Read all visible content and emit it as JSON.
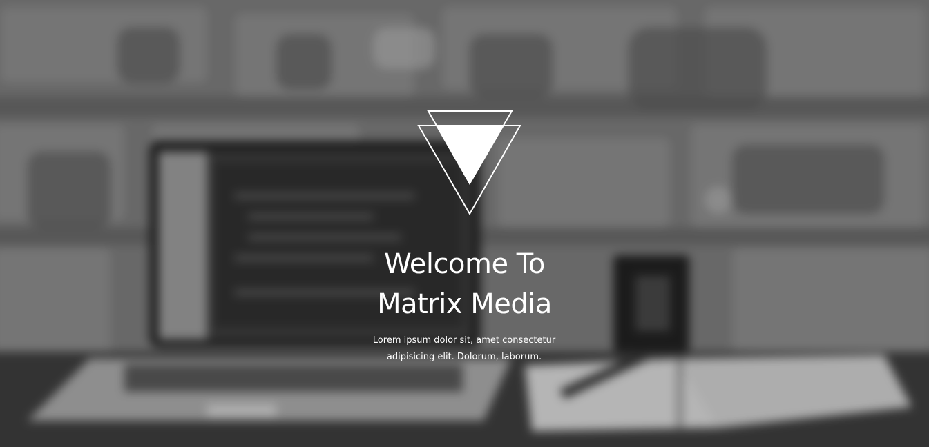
{
  "hero": {
    "title_line1": "Welcome To",
    "title_line2": "Matrix Media",
    "subtitle": "Lorem ipsum dolor sit, amet consectetur adipisicing elit. Dolorum, laborum."
  },
  "logo": {
    "icon": "triangle-logo-icon"
  },
  "colors": {
    "text": "#ffffff",
    "background_tone": "#6d6d6d"
  }
}
